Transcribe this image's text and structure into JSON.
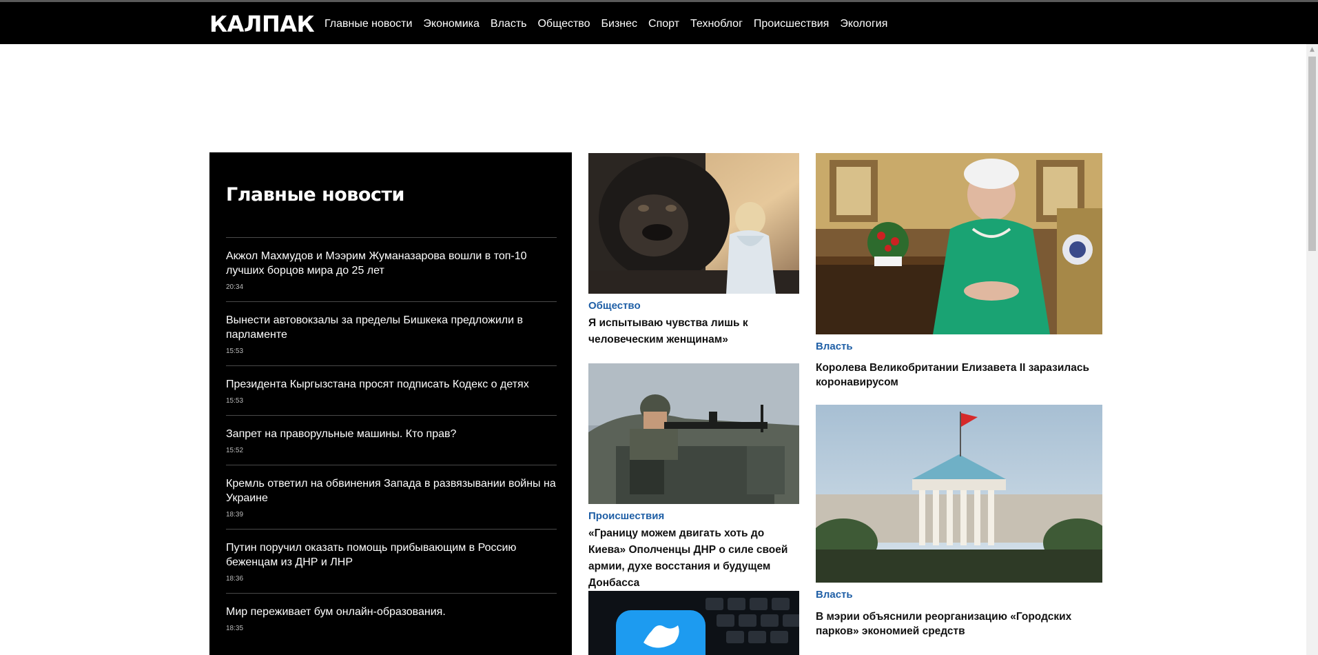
{
  "header": {
    "logo": "КАЛПАК",
    "nav": [
      "Главные новости",
      "Экономика",
      "Власть",
      "Общество",
      "Бизнес",
      "Спорт",
      "Техноблог",
      "Происшествия",
      "Экология"
    ]
  },
  "topnews": {
    "title": "Главные новости",
    "items": [
      {
        "title": "Акжол Махмудов и Мээрим Жуманазарова вошли в топ-10 лучших борцов мира до 25 лет",
        "time": "20:34"
      },
      {
        "title": "Вынести автовокзалы за пределы Бишкека предложили в парламенте",
        "time": "15:53"
      },
      {
        "title": "Президента Кыргызстана просят подписать Кодекс о детях",
        "time": "15:53"
      },
      {
        "title": "Запрет на праворульные машины. Кто прав?",
        "time": "15:52"
      },
      {
        "title": "Кремль ответил на обвинения Запада в развязывании войны на Украине",
        "time": "18:39"
      },
      {
        "title": "Путин поручил оказать помощь прибывающим в Россию беженцам из ДНР и ЛНР",
        "time": "18:36"
      },
      {
        "title": "Мир переживает бум онлайн-образования.",
        "time": "18:35"
      }
    ]
  },
  "cards": {
    "gorilla": {
      "category": "Общество",
      "title": "Я испытываю чувства лишь к человеческим женщинам»"
    },
    "soldier": {
      "category": "Происшествия",
      "title": "«Границу можем двигать хоть до Киева» Ополченцы ДНР о силе своей армии, духе восстания и будущем Донбасса"
    },
    "queen": {
      "category": "Власть",
      "title": "Королева Великобритании Елизавета II заразилась коронавирусом"
    },
    "mayor": {
      "category": "Власть",
      "title": "В мэрии объяснили реорганизацию «Городских парков» экономией средств"
    }
  },
  "colors": {
    "category": "#1f5fa6",
    "topbar": "#000000",
    "twitter": "#1d9bf0",
    "queen_dress": "#1aa373"
  }
}
